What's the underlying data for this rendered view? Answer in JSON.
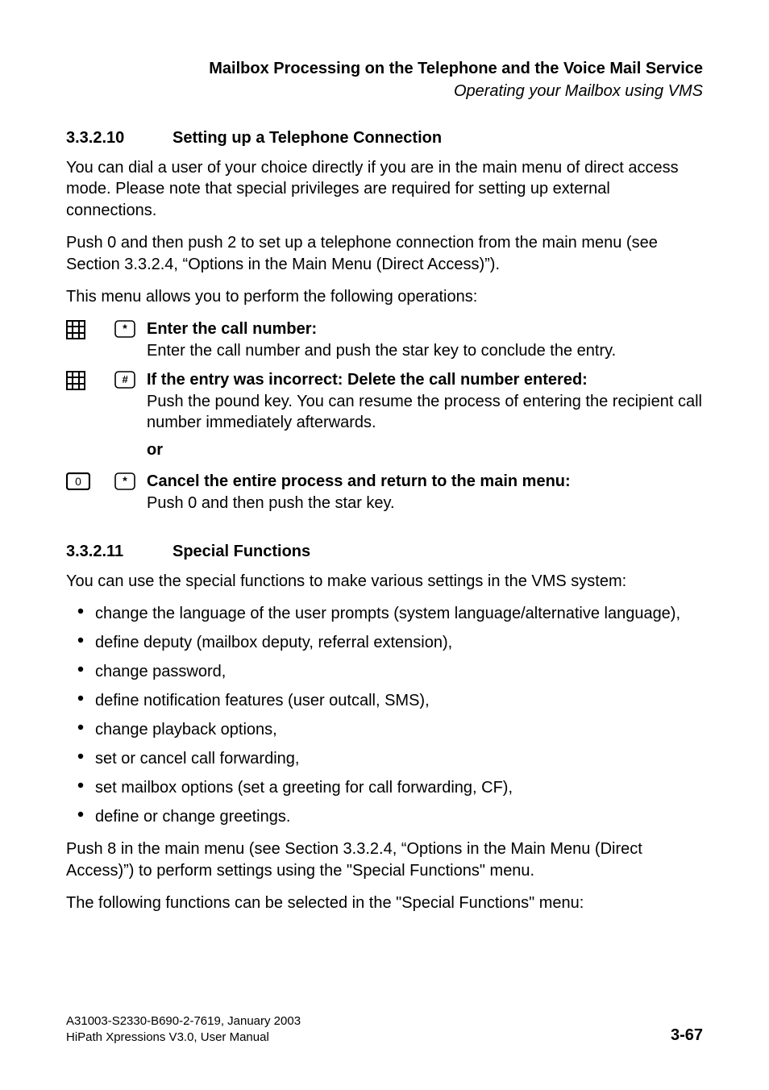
{
  "header": {
    "title": "Mailbox Processing on the Telephone and the Voice Mail Service",
    "subtitle": "Operating your Mailbox using VMS"
  },
  "section1": {
    "number": "3.3.2.10",
    "title": "Setting up a Telephone Connection",
    "p1": "You can dial a user of your choice directly if you are in the main menu of direct access mode. Please note that special privileges are required for setting up external connections.",
    "p2": "Push 0 and then push 2 to set up a telephone connection from the main menu (see Section 3.3.2.4, “Options in the Main Menu (Direct Access)”).",
    "p3": "This menu allows you to perform the following operations:",
    "step1": {
      "bold": "Enter the call number:",
      "body": "Enter the call number and push the star key to conclude the entry."
    },
    "step2": {
      "bold": "If the entry was incorrect: Delete the call number entered:",
      "body": "Push the pound key. You can resume the process of entering the recipient call number immediately afterwards."
    },
    "or": "or",
    "step3": {
      "bold": "Cancel the entire process and return to the main menu:",
      "body": "Push 0 and then push the star key."
    }
  },
  "section2": {
    "number": "3.3.2.11",
    "title": "Special Functions",
    "p1": "You can use the special functions to make various settings in the VMS system:",
    "bullets": [
      "change the language of the user prompts (system language/alternative language),",
      "define deputy (mailbox deputy, referral extension),",
      "change password,",
      "define notification features (user outcall, SMS),",
      "change playback options,",
      "set or cancel call forwarding,",
      "set mailbox options (set a greeting for call forwarding, CF),",
      "define or change greetings."
    ],
    "p2": "Push 8 in the main menu (see Section 3.3.2.4, “Options in the Main Menu (Direct Access)”) to perform settings using the \"Special Functions\" menu.",
    "p3": "The following functions can be selected in the \"Special Functions\" menu:"
  },
  "footer": {
    "line1": "A31003-S2330-B690-2-7619, January 2003",
    "line2": "HiPath Xpressions V3.0, User Manual",
    "pageno": "3-67"
  }
}
